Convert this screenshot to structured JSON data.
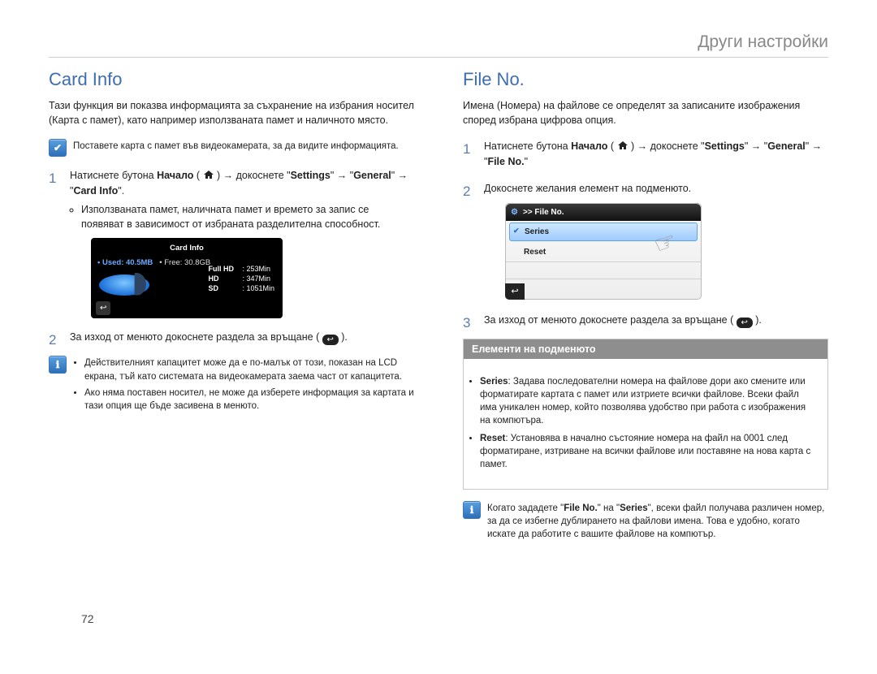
{
  "header": "Други настройки",
  "page_number": "72",
  "left": {
    "title": "Card Info",
    "intro": "Тази функция ви показва информацията за съхранение на избрания носител (Карта с памет), като например използваната памет и наличното място.",
    "insert_note": "Поставете карта с памет във видеокамерата, за да видите информацията.",
    "step1_pre": "Натиснете бутона ",
    "step1_home_bold": "Начало",
    "step1_after_home": " ( ",
    "step1_after_icon": " ) → докоснете \"",
    "step1_settings": "Settings",
    "step1_arrow_gen": "\" → \"",
    "step1_general": "General",
    "step1_arrow_ci": "\" → \"",
    "step1_cardinfo": "Card Info",
    "step1_end": "\".",
    "step1_bullet": "Използваната памет, наличната памет и времето за запис се появяват в зависимост от избраната разделителна способност.",
    "lcd": {
      "title": "Card Info",
      "used_label": "• Used: 40.5MB",
      "free_label": "• Free: 30.8GB",
      "rows": [
        {
          "k": "Full HD",
          "v": ": 253Min"
        },
        {
          "k": "HD",
          "v": ": 347Min"
        },
        {
          "k": "SD",
          "v": ": 1051Min"
        }
      ]
    },
    "step2_pre": "За изход от менюто докоснете раздела за връщане ( ",
    "step2_post": " ).",
    "note_items": [
      "Действителният капацитет може да е по-малък от този, показан на LCD екрана, тъй като системата на видеокамерата заема част от капацитета.",
      "Ако няма поставен носител, не може да изберете информация за картата и тази опция ще бъде засивена в менюто."
    ]
  },
  "right": {
    "title": "File No.",
    "intro": "Имена (Номера) на файлове се определят за записаните изображения според избрана цифрова опция.",
    "step1_pre": "Натиснете бутона ",
    "step1_home_bold": "Начало",
    "step1_after_icon": " ) → докоснете \"",
    "step1_settings": "Settings",
    "step1_arrow_gen": "\" → \"",
    "step1_general": "General",
    "step1_arrow_fn": "\" → \"",
    "step1_fileno": "File No.",
    "step1_end": "\"",
    "step2": "Докоснете желания елемент на подменюто.",
    "menu": {
      "bc": ">> File No.",
      "item_sel": "Series",
      "item2": "Reset"
    },
    "step3_pre": "За изход от менюто докоснете раздела за връщане ( ",
    "step3_post": " ).",
    "submenu_title": "Елементи на подменюто",
    "sub_series_k": "Series",
    "sub_series_v": ": Задава последователни номера на файлове дори ако смените или форматирате картата с памет или изтриете всички файлове. Всеки файл има уникален номер, който позволява удобство при работа с изображения на компютъра.",
    "sub_reset_k": "Reset",
    "sub_reset_v": ": Установява в начално състояние номера на файл на 0001 след форматиране, изтриване на всички файлове или поставяне на нова карта с памет.",
    "tip": "Когато зададете \"File No.\" на \"Series\", всеки файл получава различен номер, за да се избегне дублирането на файлови имена. Това е удобно, когато искате да работите с вашите файлове на компютър.",
    "tip_bold1": "File No.",
    "tip_bold2": "Series"
  }
}
